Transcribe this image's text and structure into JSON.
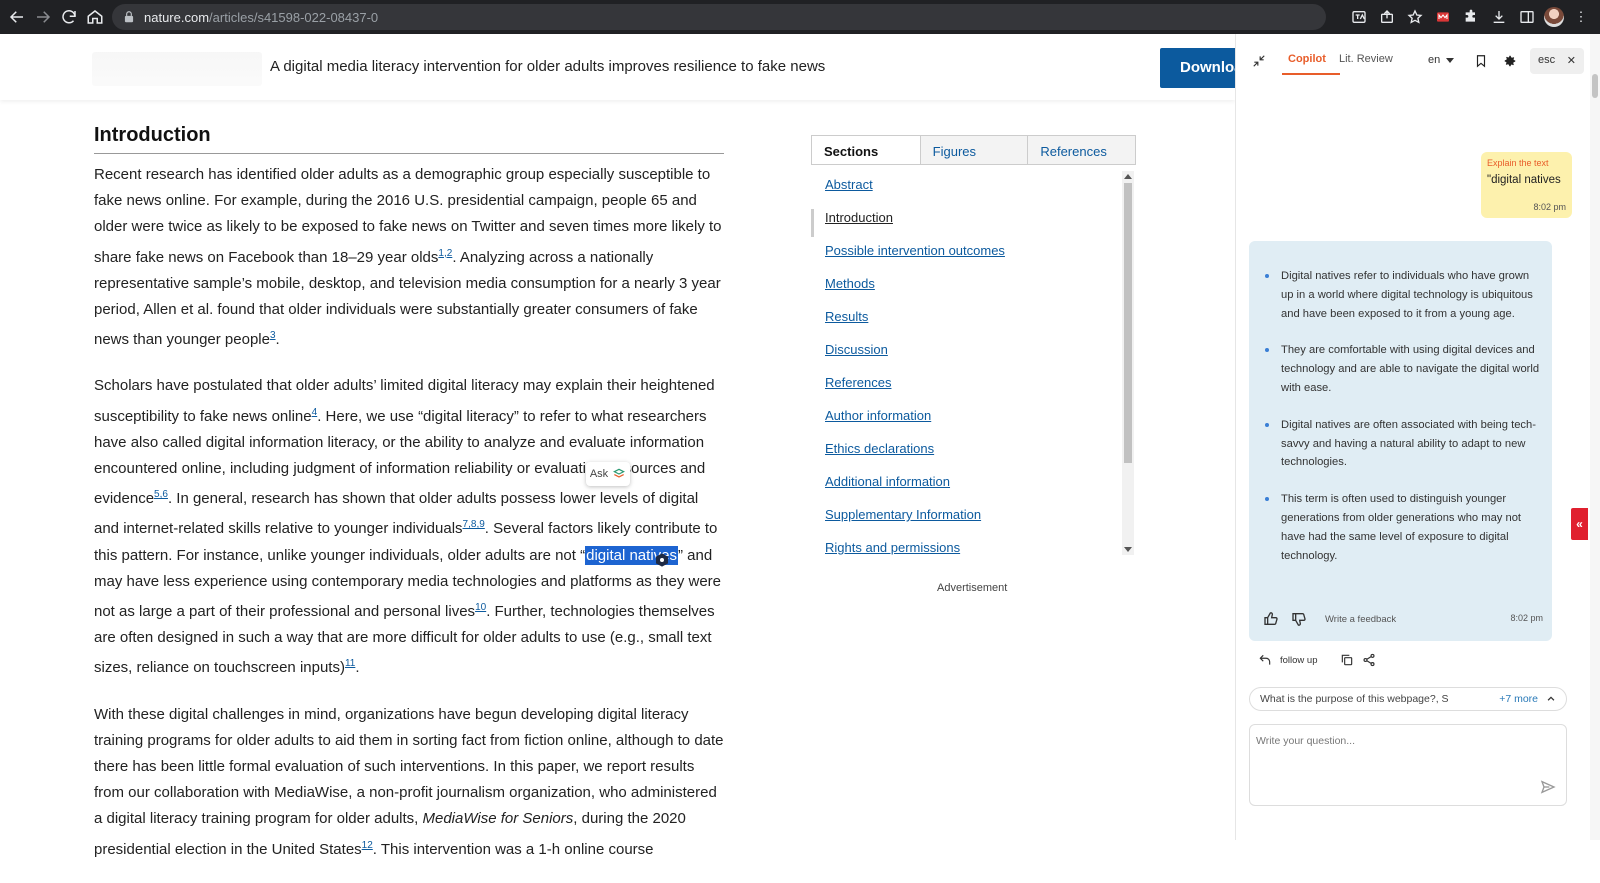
{
  "browser": {
    "url_host": "nature.com",
    "url_path": "/articles/s41598-022-08437-0"
  },
  "header": {
    "title": "A digital media literacy intervention for older adults improves resilience to fake news",
    "download_label": "Downloa"
  },
  "article": {
    "heading": "Introduction",
    "p1": {
      "a": "Recent research has identified older adults as a demographic group especially susceptible to fake news online. For example, during the 2016 U.S. presidential campaign, people 65 and older were twice as likely to be exposed to fake news on Twitter and seven times more likely to share fake news on Facebook than 18–29 year olds",
      "ref1": "1,2",
      "b": ". Analyzing across a nationally representative sample’s mobile, desktop, and television media consumption for a nearly 3 year period, Allen et al. found that older individuals were substantially greater consumers of fake news than younger people",
      "ref2": "3",
      "c": "."
    },
    "p2": {
      "a": "Scholars have postulated that older adults’ limited digital literacy may explain their heightened susceptibility to fake news online",
      "ref1": "4",
      "b": ". Here, we use “digital literacy” to refer to what researchers have also called digital information literacy, or the ability to analyze and evaluate information encountered online, including judgment of information reliability or evaluation of sources and evidence",
      "ref2": "5,6",
      "c": ". In general, research has shown that older adults possess lower levels of digital and internet-related skills relative to younger individuals",
      "ref3": "7,8,9",
      "d": ". Several factors likely contribute to this pattern. For instance, unlike younger individuals, older adults are not “",
      "highlight": "digital natives",
      "e": "” and may have less experience using contemporary media technologies and platforms as they were not as large a part of their professional and personal lives",
      "ref4": "10",
      "f": ". Further, technologies themselves are often designed in such a way that are more difficult for older adults to use (e.g., small text sizes, reliance on touchscreen inputs)",
      "ref5": "11",
      "g": "."
    },
    "p3": {
      "a": "With these digital challenges in mind, organizations have begun developing digital literacy training programs for older adults to aid them in sorting fact from fiction online, although to date there has been little formal evaluation of such interventions. In this paper, we report results from our collaboration with MediaWise, a non-profit journalism organization, who administered a digital literacy training program for older adults, ",
      "em": "MediaWise for Seniors",
      "b": ", during the 2020 presidential election in the United States",
      "ref1": "12",
      "c": ". This intervention was a 1-h online course"
    },
    "ask_label": "Ask"
  },
  "toc": {
    "tabs": [
      "Sections",
      "Figures",
      "References"
    ],
    "items": [
      "Abstract",
      "Introduction",
      "Possible intervention outcomes",
      "Methods",
      "Results",
      "Discussion",
      "References",
      "Author information",
      "Ethics declarations",
      "Additional information",
      "Supplementary Information",
      "Rights and permissions"
    ],
    "active_index": 1,
    "advertisement": "Advertisement"
  },
  "copilot": {
    "tabs": [
      "Copilot",
      "Lit. Review"
    ],
    "active_tab": "Copilot",
    "language": "en",
    "esc_label": "esc",
    "user_message": {
      "tag": "Explain the text",
      "quote": "\"digital natives",
      "time": "8:02 pm"
    },
    "bot_message": {
      "bullets": [
        "Digital natives refer to individuals who have grown up in a world where digital technology is ubiquitous and have been exposed to it from a young age.",
        "They are comfortable with using digital devices and technology and are able to navigate the digital world with ease.",
        "Digital natives are often associated with being tech-savvy and having a natural ability to adapt to new technologies.",
        "This term is often used to distinguish younger generations from older generations who may not have had the same level of exposure to digital technology."
      ],
      "feedback_label": "Write a feedback",
      "time": "8:02 pm"
    },
    "follow_up_label": "follow up",
    "suggestion": "What is the purpose of this webpage?, S",
    "more_label": "+7 more",
    "question_placeholder": "Write your question...",
    "side_tab_glyph": "«"
  },
  "colors": {
    "accent": "#e85d2a",
    "link": "#0c5a9e",
    "highlight": "#1d64d1",
    "bot_bubble": "#e0edf4",
    "user_bubble": "#fdf1ad"
  }
}
